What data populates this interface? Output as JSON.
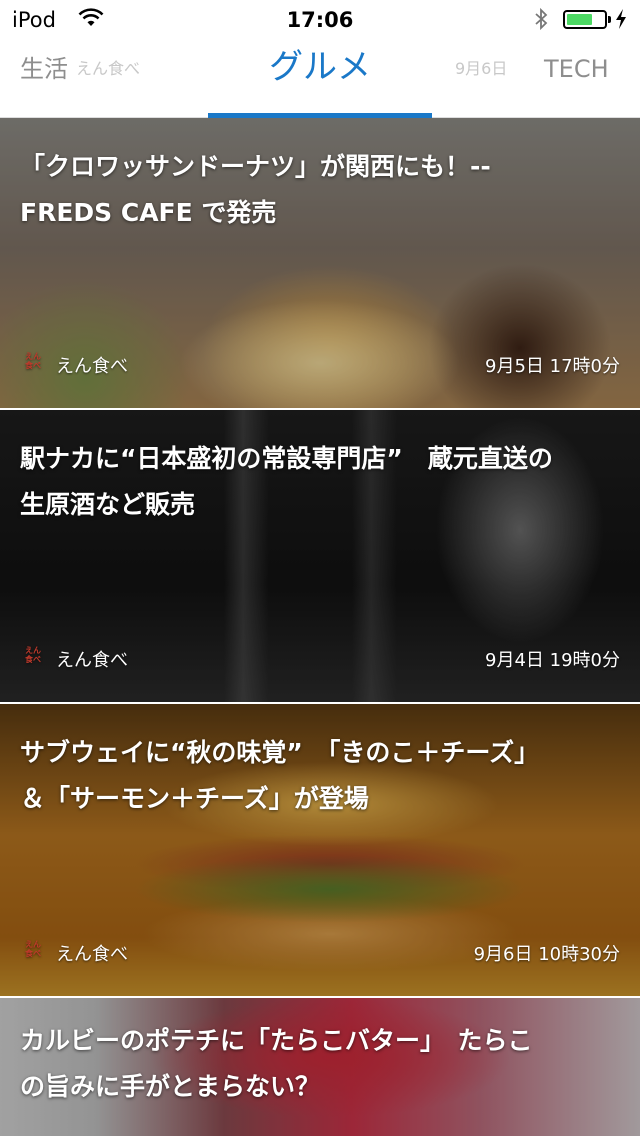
{
  "status_bar": {
    "carrier": "iPod",
    "time": "17:06",
    "battery_level": 0.7,
    "colors": {
      "battery": "#4cd964"
    }
  },
  "tabs": {
    "left": "生活",
    "left_ghost": "えん食べ",
    "active": "グルメ",
    "right_ghost": "9月6日",
    "right": "TECH",
    "accent": "#1a78c8"
  },
  "articles": [
    {
      "title_line1": "「クロワッサンドーナツ」が関西にも！--",
      "title_line2": "FREDS CAFE で発売",
      "source": "えん食べ",
      "date": "9月5日 17時0分"
    },
    {
      "title_line1": "駅ナカに“日本盛初の常設専門店”　蔵元直送の",
      "title_line2": "生原酒など販売",
      "source": "えん食べ",
      "date": "9月4日 19時0分"
    },
    {
      "title_line1": "サブウェイに“秋の味覚”　「きのこ＋チーズ」",
      "title_line2": "＆「サーモン＋チーズ」が登場",
      "source": "えん食べ",
      "date": "9月6日 10時30分"
    },
    {
      "title_line1": "カルビーのポテチに「たらこバター」　たらこ",
      "title_line2": "の旨みに手がとまらない？"
    }
  ],
  "source_logo_text": "えん食べ",
  "icons": [
    "wifi-icon",
    "bluetooth-icon",
    "battery-icon",
    "charging-bolt-icon",
    "source-logo-icon"
  ]
}
